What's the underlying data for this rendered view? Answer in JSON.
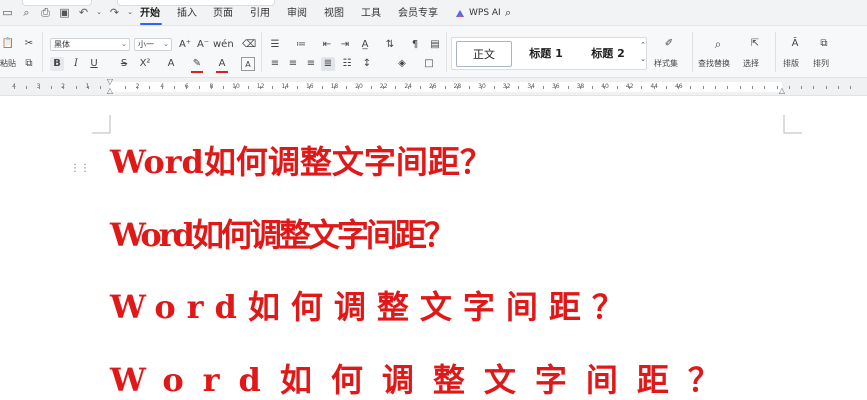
{
  "menu": {
    "items": [
      "开始",
      "插入",
      "页面",
      "引用",
      "审阅",
      "视图",
      "工具",
      "会员专享"
    ],
    "active": "开始",
    "wps_ai": "WPS AI"
  },
  "ribbon": {
    "font_name": "黑体",
    "font_size": "小一",
    "paste_label": "粘贴",
    "styles": [
      "正文",
      "标题 1",
      "标题 2"
    ],
    "style_set_label": "样式集",
    "find_replace_label": "查找替换",
    "select_label": "选择",
    "typeset_label": "排版",
    "arrange_label": "排列"
  },
  "ruler": {
    "left_numbers": [
      "4",
      "3",
      "2",
      "1"
    ],
    "right_numbers": [
      "2",
      "4",
      "6",
      "8",
      "10",
      "12",
      "14",
      "16",
      "18",
      "20",
      "22",
      "24",
      "26",
      "28",
      "30",
      "32",
      "34",
      "36",
      "38",
      "40",
      "42",
      "44",
      "46"
    ]
  },
  "document": {
    "lines": [
      "Word如何调整文字间距？",
      "Word如何调整文字间距？",
      "Word如何调整文字间距？",
      "Word如何调整文字间距？"
    ]
  },
  "colors": {
    "text_red": "#e01818",
    "accent_blue": "#2a68f5"
  }
}
